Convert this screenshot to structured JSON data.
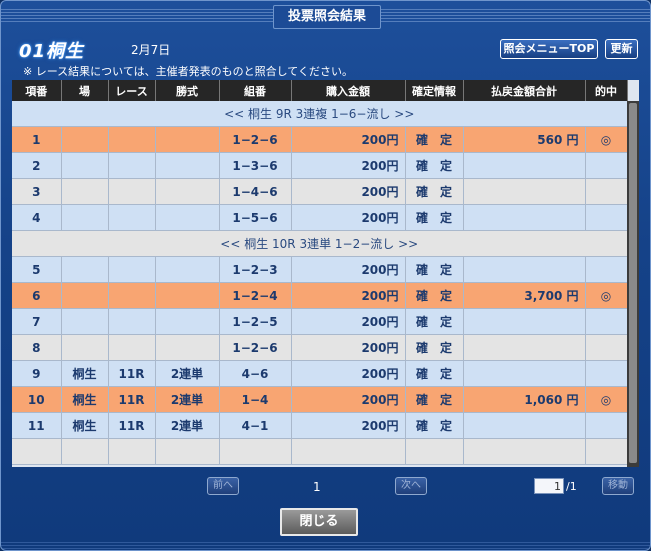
{
  "window": {
    "title": "投票照会結果"
  },
  "header": {
    "venue": "01桐生",
    "date": "2月7日",
    "note": "※ レース結果については、主催者発表のものと照合してください。",
    "menu_top_label": "照会メニューTOP",
    "refresh_label": "更新"
  },
  "columns": [
    "項番",
    "場",
    "レース",
    "勝式",
    "組番",
    "購入金額",
    "確定情報",
    "払戻金額合計",
    "的中"
  ],
  "groups": {
    "g1": "<< 桐生 9R 3連複 1−6−流し >>",
    "g2": "<< 桐生 10R 3連単 1−2−流し >>"
  },
  "rows": [
    {
      "no": "1",
      "place": "",
      "race": "",
      "type": "",
      "combo": "1−2−6",
      "amount": "200円",
      "status": "確　定",
      "payout": "560 円",
      "hit": "◎"
    },
    {
      "no": "2",
      "place": "",
      "race": "",
      "type": "",
      "combo": "1−3−6",
      "amount": "200円",
      "status": "確　定",
      "payout": "",
      "hit": ""
    },
    {
      "no": "3",
      "place": "",
      "race": "",
      "type": "",
      "combo": "1−4−6",
      "amount": "200円",
      "status": "確　定",
      "payout": "",
      "hit": ""
    },
    {
      "no": "4",
      "place": "",
      "race": "",
      "type": "",
      "combo": "1−5−6",
      "amount": "200円",
      "status": "確　定",
      "payout": "",
      "hit": ""
    },
    {
      "no": "5",
      "place": "",
      "race": "",
      "type": "",
      "combo": "1−2−3",
      "amount": "200円",
      "status": "確　定",
      "payout": "",
      "hit": ""
    },
    {
      "no": "6",
      "place": "",
      "race": "",
      "type": "",
      "combo": "1−2−4",
      "amount": "200円",
      "status": "確　定",
      "payout": "3,700 円",
      "hit": "◎"
    },
    {
      "no": "7",
      "place": "",
      "race": "",
      "type": "",
      "combo": "1−2−5",
      "amount": "200円",
      "status": "確　定",
      "payout": "",
      "hit": ""
    },
    {
      "no": "8",
      "place": "",
      "race": "",
      "type": "",
      "combo": "1−2−6",
      "amount": "200円",
      "status": "確　定",
      "payout": "",
      "hit": ""
    },
    {
      "no": "9",
      "place": "桐生",
      "race": "11R",
      "type": "2連単",
      "combo": "4−6",
      "amount": "200円",
      "status": "確　定",
      "payout": "",
      "hit": ""
    },
    {
      "no": "10",
      "place": "桐生",
      "race": "11R",
      "type": "2連単",
      "combo": "1−4",
      "amount": "200円",
      "status": "確　定",
      "payout": "1,060 円",
      "hit": "◎"
    },
    {
      "no": "11",
      "place": "桐生",
      "race": "11R",
      "type": "2連単",
      "combo": "4−1",
      "amount": "200円",
      "status": "確　定",
      "payout": "",
      "hit": ""
    }
  ],
  "pager": {
    "prev_label": "前へ",
    "current_page": "1",
    "next_label": "次へ",
    "page_input_value": "1",
    "total_pages": "/1",
    "go_label": "移動"
  },
  "footer": {
    "close_label": "閉じる"
  },
  "colors": {
    "header_bg": "#262626",
    "row_blue": "#cfe0f4",
    "row_gray": "#e4e4e4",
    "row_hit": "#f8a572",
    "window_bg": "#154288"
  }
}
